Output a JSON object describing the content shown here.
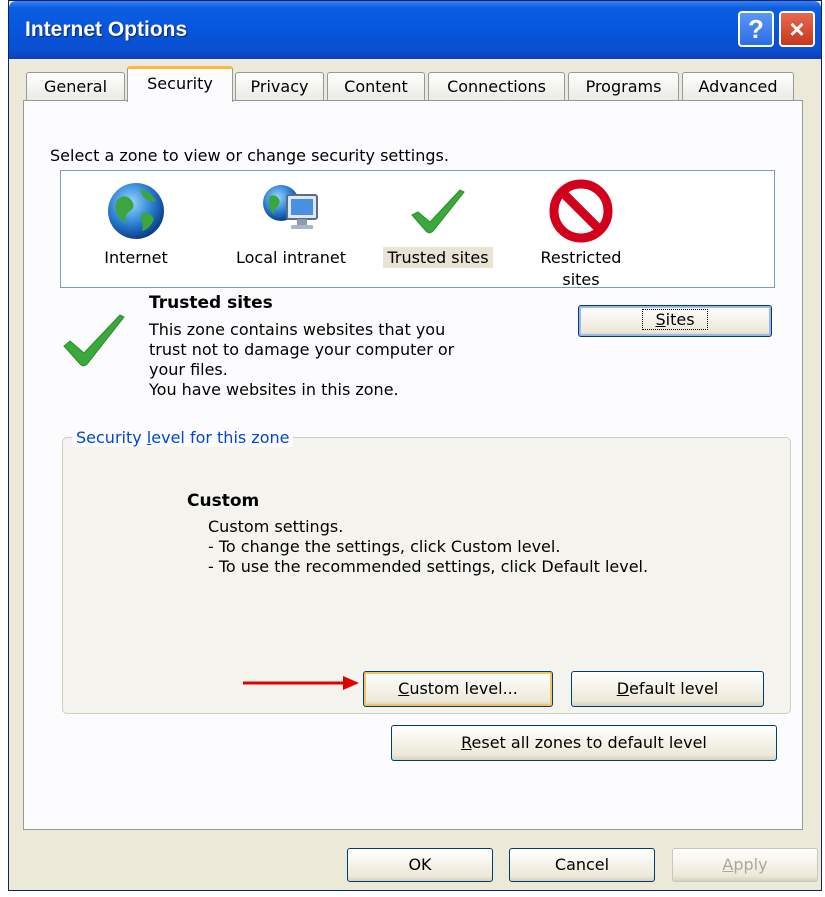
{
  "window": {
    "title": "Internet Options"
  },
  "titlebar": {
    "help_glyph": "?",
    "close_glyph": "×"
  },
  "tabs": [
    {
      "label": "General"
    },
    {
      "label": "Security"
    },
    {
      "label": "Privacy"
    },
    {
      "label": "Content"
    },
    {
      "label": "Connections"
    },
    {
      "label": "Programs"
    },
    {
      "label": "Advanced"
    }
  ],
  "security": {
    "zone_prompt": "Select a zone to view or change security settings.",
    "zones": [
      {
        "label_line1": "Internet",
        "label_line2": "",
        "icon": "globe-icon"
      },
      {
        "label_line1": "Local intranet",
        "label_line2": "",
        "icon": "intranet-icon"
      },
      {
        "label_line1": "Trusted sites",
        "label_line2": "",
        "icon": "checkmark-icon"
      },
      {
        "label_line1": "Restricted",
        "label_line2": "sites",
        "icon": "restricted-icon"
      }
    ],
    "selected_zone": {
      "title": "Trusted sites",
      "desc_line1": "This zone contains websites that you",
      "desc_line2": "trust not to damage your computer or",
      "desc_line3": "your files.",
      "desc_line4": "You have websites in this zone."
    },
    "sites_button": {
      "accesskey": "S",
      "rest": "ites"
    },
    "level_group": {
      "legend_pre": "Security ",
      "legend_key": "l",
      "legend_post": "evel for this zone",
      "level_name": "Custom",
      "desc_line1": "Custom settings.",
      "desc_line2": "- To change the settings, click Custom level.",
      "desc_line3": "- To use the recommended settings, click Default level."
    },
    "custom_level_button": {
      "accesskey": "C",
      "rest": "ustom level..."
    },
    "default_level_button": {
      "accesskey": "D",
      "rest": "efault level"
    },
    "reset_button": {
      "accesskey": "R",
      "rest": "eset all zones to default level"
    }
  },
  "footer": {
    "ok_label": "OK",
    "cancel_label": "Cancel",
    "apply_accesskey": "A",
    "apply_rest": "pply"
  },
  "colors": {
    "titlebar": "#0855dd",
    "dialog_face": "#ece9d8",
    "active_tab_accent": "#fbb83a",
    "legend_text": "#0046d5",
    "annotation_arrow": "#e00000",
    "check_green": "#3aa83a",
    "restricted_red": "#d2001b"
  }
}
